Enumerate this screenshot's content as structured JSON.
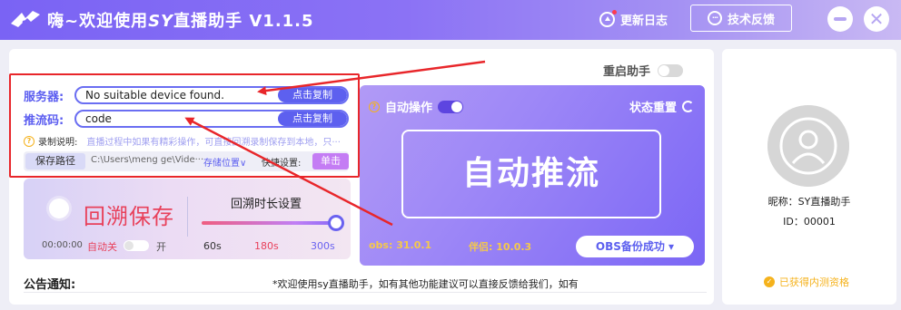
{
  "titlebar": {
    "title_prefix": "嗨~欢迎使用",
    "title_brand": "SY",
    "title_suffix": "直播助手 V1.1.5",
    "changelog_label": "更新日志",
    "feedback_label": "技术反馈"
  },
  "main": {
    "restart_label": "重启助手",
    "server_label": "服务器:",
    "server_value": "No suitable device found.",
    "stream_key_label": "推流码:",
    "stream_key_value": "code",
    "copy_label": "点击复制",
    "record_note_label": "录制说明:",
    "record_note_desc": "直播过程中如果有精彩操作，可直接回溯录制保存到本地，只···",
    "save_path_button": "保存路径",
    "save_path_value": "C:\\Users\\meng ge\\Vide···",
    "storage_location": "存储位置∨",
    "hotkey_label": "快捷设置:",
    "single_button": "单击"
  },
  "replay": {
    "title": "回溯保存",
    "time": "00:00:00",
    "auto_off": "自动关",
    "auto_on": "开",
    "duration_title": "回溯时长设置",
    "ticks": [
      "60s",
      "180s",
      "300s"
    ],
    "slider_value_fraction": 1.0
  },
  "auto": {
    "auto_op_label": "自动操作",
    "reset_label": "状态重置",
    "push_label": "自动推流",
    "obs_version": "obs: 31.0.1",
    "partner_version": "伴侣: 10.0.3",
    "obs_backup": "OBS备份成功 ▾"
  },
  "notice": {
    "label": "公告通知:",
    "text": "*欢迎使用sy直播助手，如有其他功能建议可以直接反馈给我们，如有"
  },
  "profile": {
    "nickname": "昵称：SY直播助手",
    "id": "ID：00001",
    "badge": "已获得内测资格"
  },
  "colors": {
    "accent": "#6a6ef2",
    "annotation_red": "#e8262a",
    "replay_red": "#e8415b",
    "gold": "#f5b21c"
  }
}
